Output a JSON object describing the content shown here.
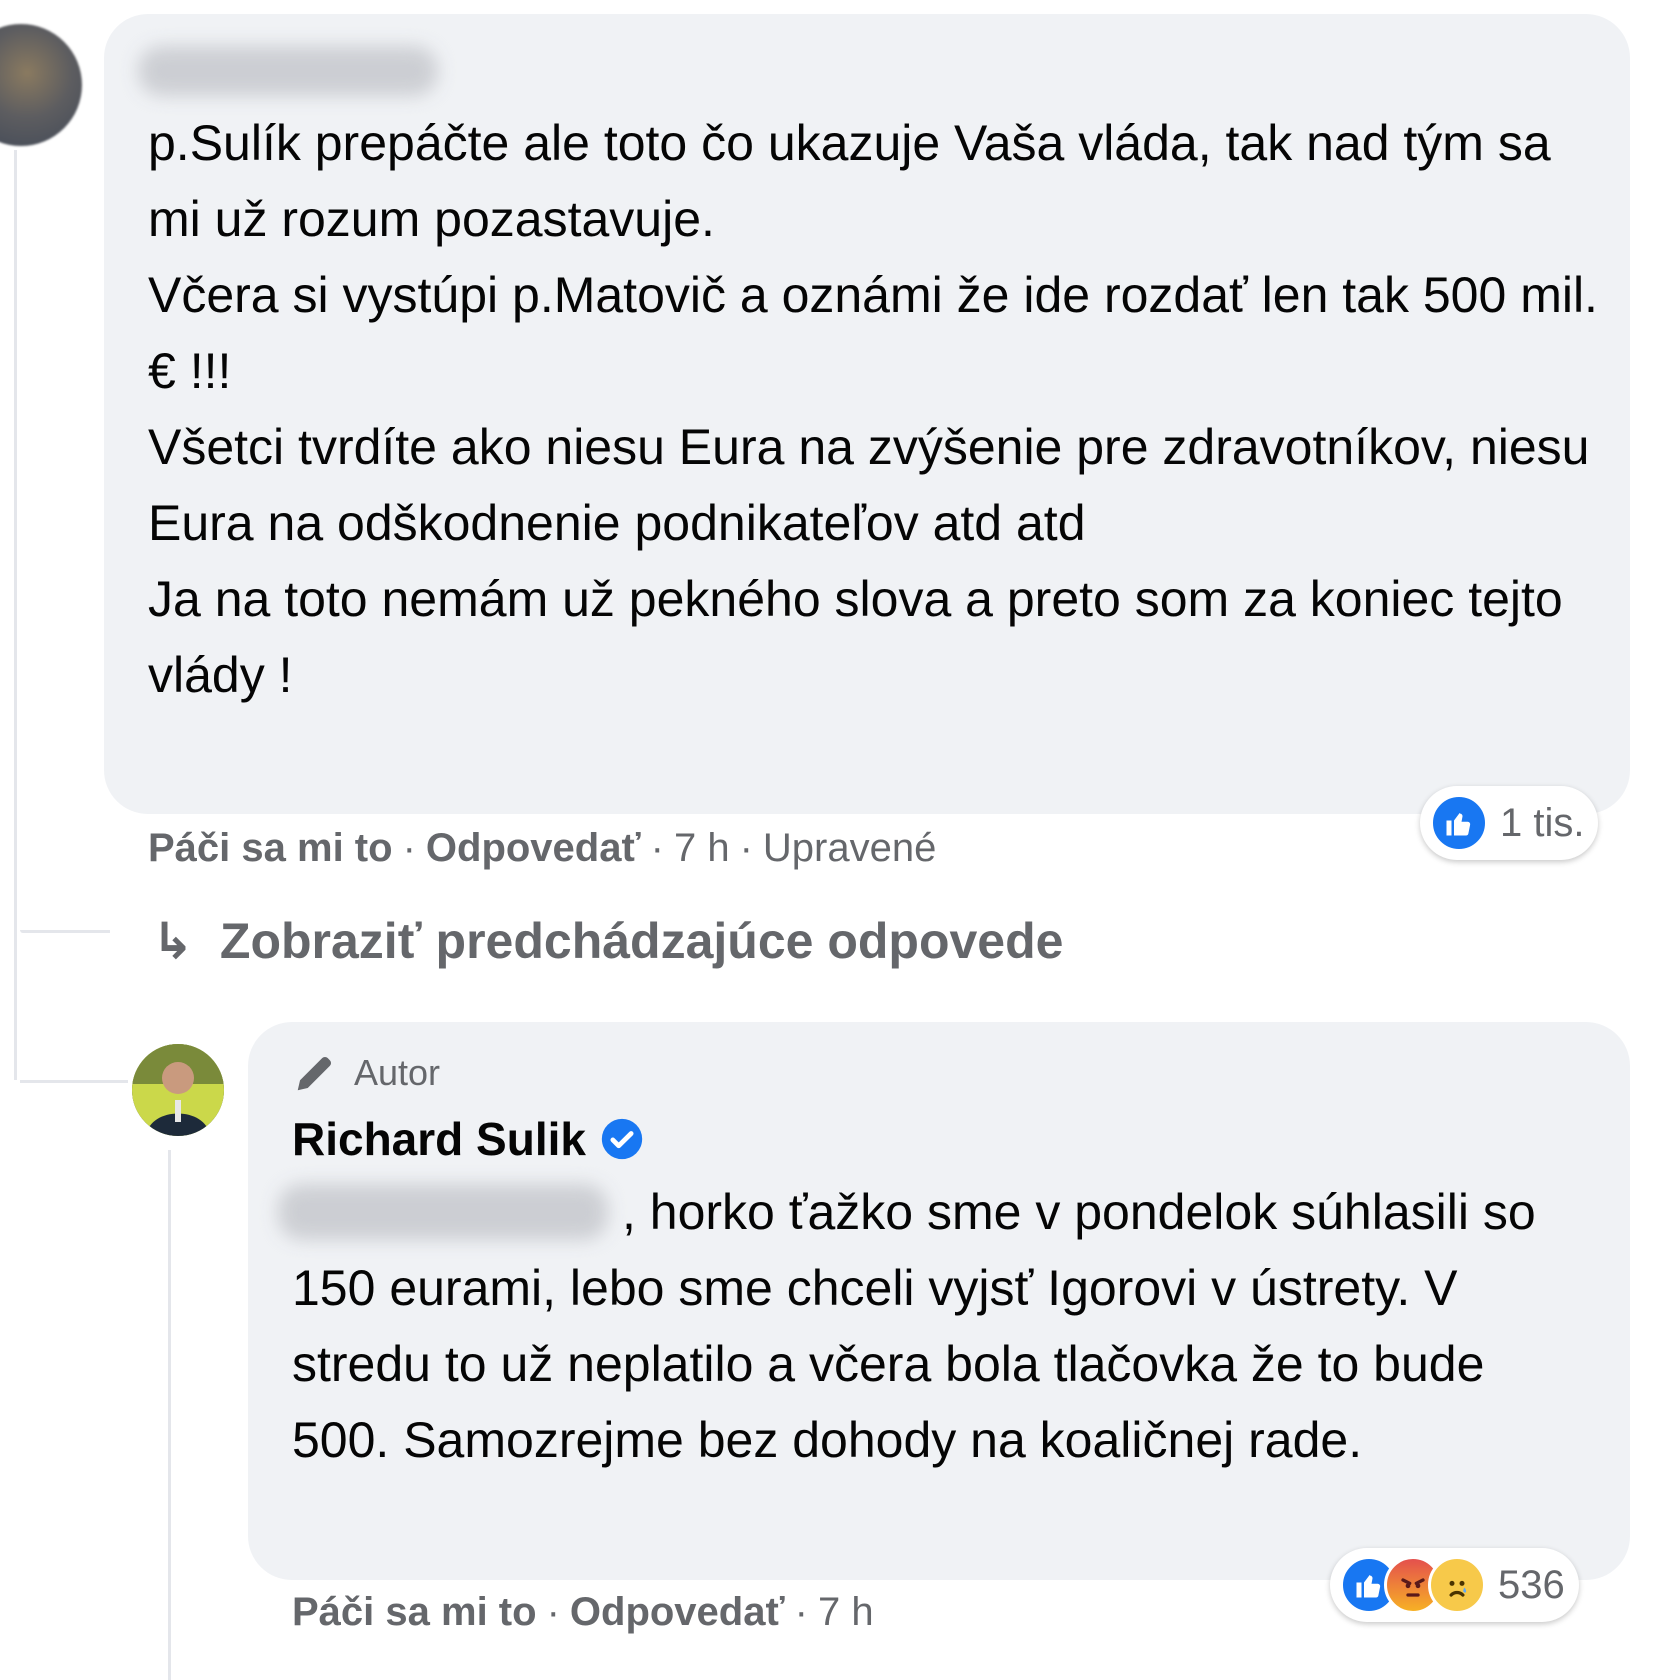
{
  "comment1": {
    "author_name": "",
    "text": "p.Sulík prepáčte ale toto čo ukazuje Vaša vláda, tak nad tým sa mi už rozum pozastavuje.\nVčera si vystúpi p.Matovič a oznámi že ide rozdať len tak 500 mil. € !!!\nVšetci tvrdíte ako niesu Eura na zvýšenie pre zdravotníkov, niesu Eura na odškodnenie podnikateľov atd atd\nJa na toto nemám už pekného slova a preto som za koniec tejto vlády !",
    "like_label": "Páči sa mi to",
    "reply_label": "Odpovedať",
    "time": "7 h",
    "edited_label": "Upravené",
    "reaction_count": "1 tis."
  },
  "view_previous_label": "Zobraziť predchádzajúce odpovede",
  "comment2": {
    "badge_label": "Autor",
    "author_name": "Richard Sulik",
    "text": ", horko ťažko sme v pondelok súhlasili so 150 eurami, lebo sme chceli vyjsť Igorovi v ústrety. V stredu to už neplatilo a včera bola tlačovka že to bude 500. Samozrejme bez dohody na koaličnej rade.",
    "like_label": "Páči sa mi to",
    "reply_label": "Odpovedať",
    "time": "7 h",
    "reaction_count": "536"
  },
  "separator": "·",
  "icons": {
    "like": "like-icon",
    "angry": "angry-icon",
    "sad": "sad-icon",
    "verified": "verified-badge-icon",
    "author_badge": "pencil-icon",
    "reply_arrow": "reply-arrow-icon"
  },
  "colors": {
    "bubble": "#f0f2f5",
    "secondary_text": "#65676b",
    "like_blue": "#1877f2"
  }
}
